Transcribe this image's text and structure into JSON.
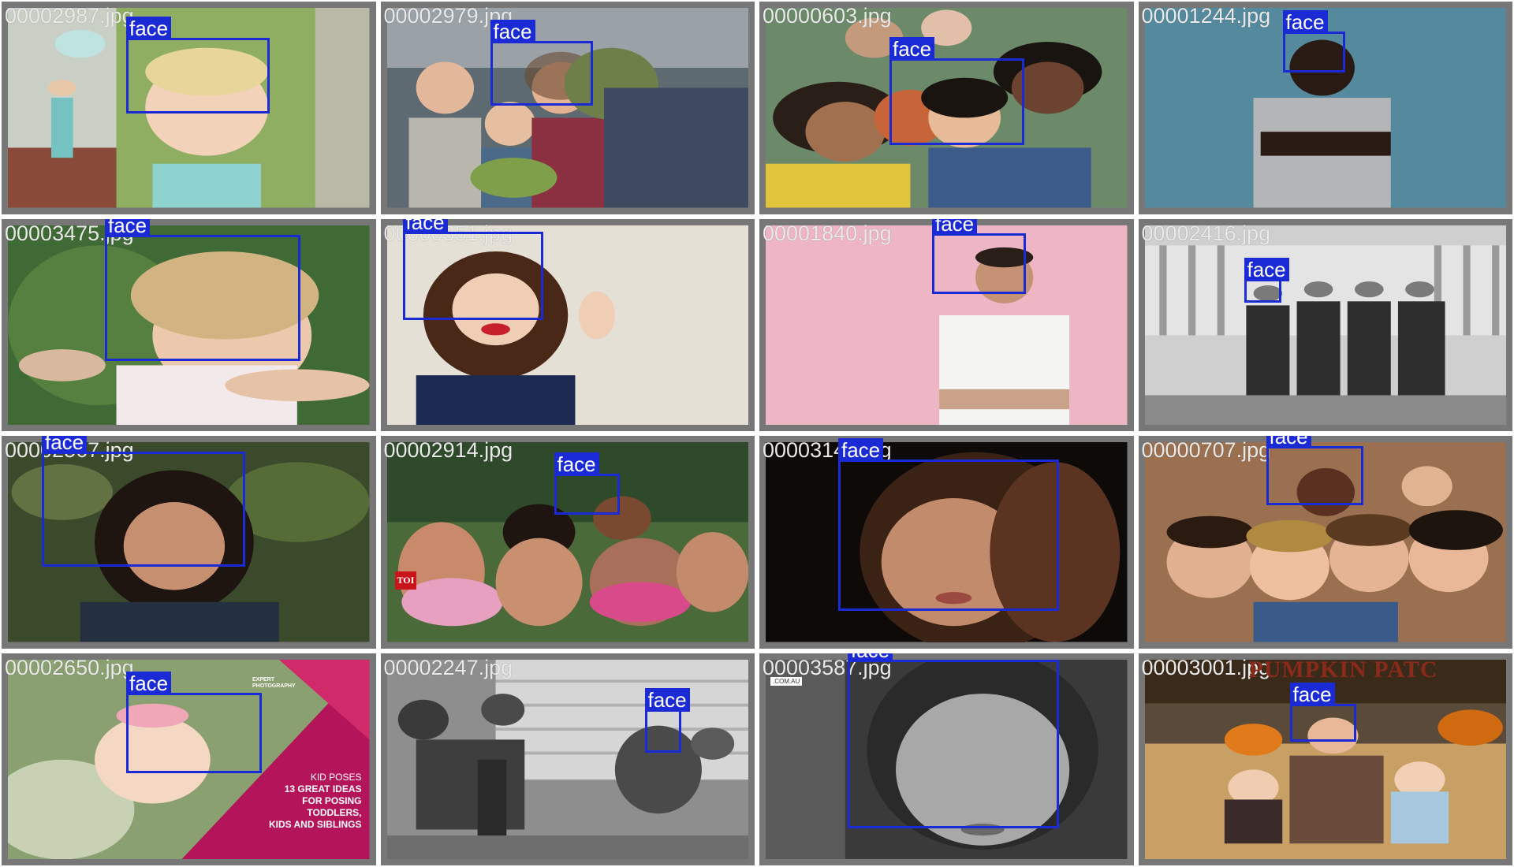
{
  "colors": {
    "box": "#1a2bd6",
    "label_bg": "#1a2bd6",
    "label_text": "#ffffff",
    "tile_frame": "#777777",
    "filename_text": "#e9e9e9"
  },
  "tiles": [
    {
      "filename": "00002987.jpg",
      "label": "face"
    },
    {
      "filename": "00002979.jpg",
      "label": "face"
    },
    {
      "filename": "00000603.jpg",
      "label": "face"
    },
    {
      "filename": "00001244.jpg",
      "label": "face"
    },
    {
      "filename": "00003475.jpg",
      "label": "face"
    },
    {
      "filename": "00000351.jpg",
      "label": "face"
    },
    {
      "filename": "00001840.jpg",
      "label": "face"
    },
    {
      "filename": "00002416.jpg",
      "label": "face"
    },
    {
      "filename": "00002567.jpg",
      "label": "face"
    },
    {
      "filename": "00002914.jpg",
      "label": "face",
      "watermark": "TOI"
    },
    {
      "filename": "00003140.jpg",
      "label": "face"
    },
    {
      "filename": "00000707.jpg",
      "label": "face"
    },
    {
      "filename": "00002650.jpg",
      "label": "face",
      "overlay": {
        "brand": "EXPERT PHOTOGRAPHY",
        "lines": [
          "KID POSES",
          "13 GREAT IDEAS",
          "FOR POSING",
          "TODDLERS,",
          "KIDS AND SIBLINGS"
        ]
      }
    },
    {
      "filename": "00002247.jpg",
      "label": "face"
    },
    {
      "filename": "00003587.jpg",
      "label": "face",
      "watermark": ".COM.AU"
    },
    {
      "filename": "00003001.jpg",
      "label": "face",
      "sign": "PUMPKIN PATC"
    }
  ]
}
